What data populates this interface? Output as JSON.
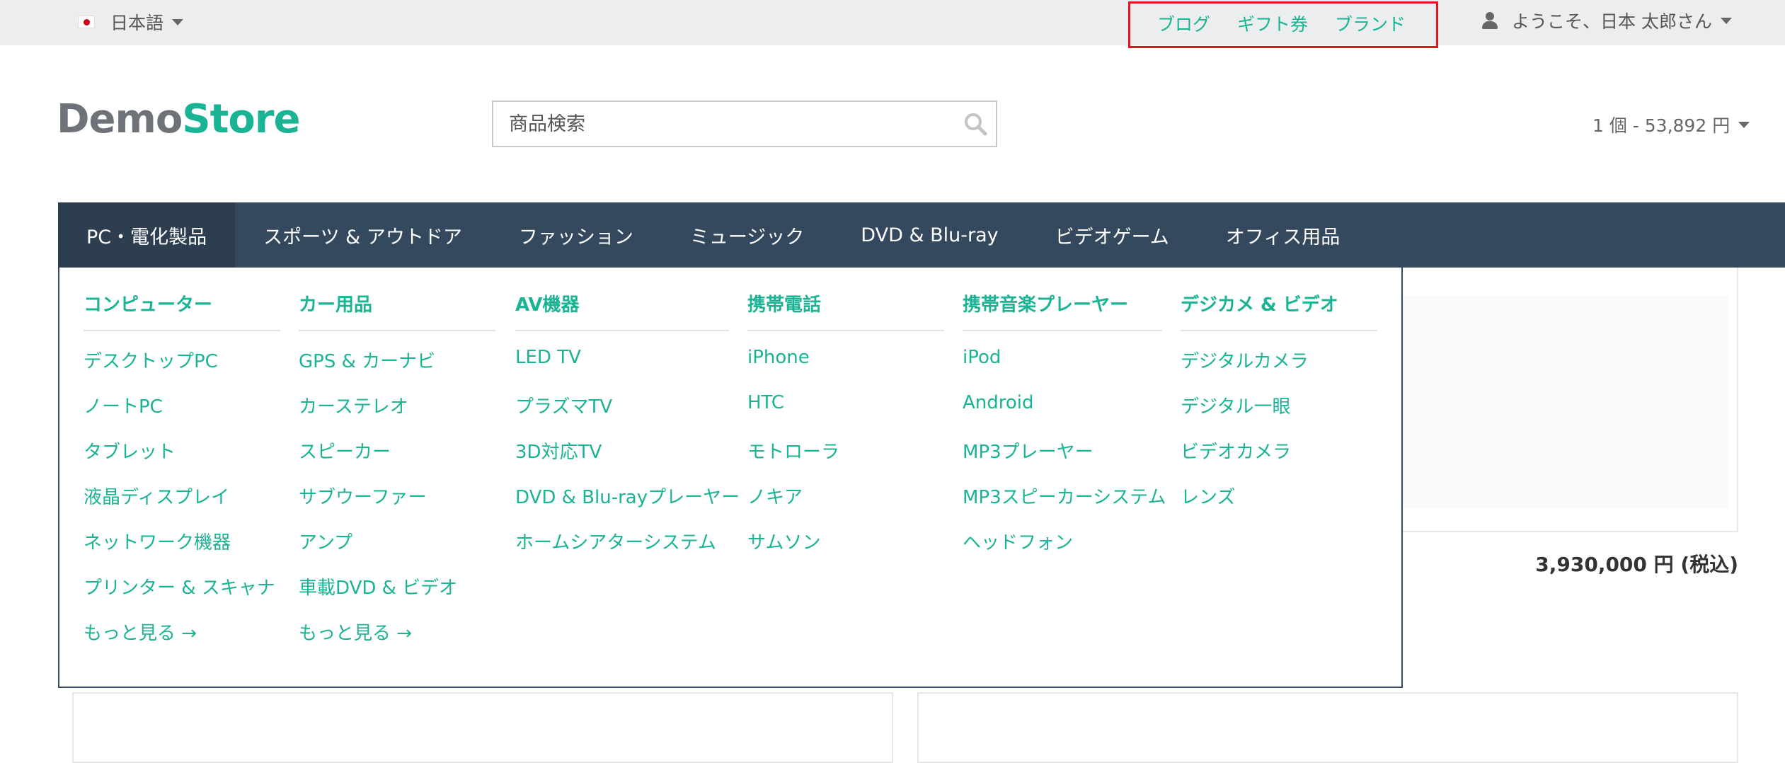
{
  "topbar": {
    "language": {
      "flag": "japan-flag",
      "label": "日本語"
    },
    "links": [
      {
        "label": "ブログ"
      },
      {
        "label": "ギフト券"
      },
      {
        "label": "ブランド"
      }
    ],
    "user": {
      "greeting": "ようこそ、日本 太郎さん"
    }
  },
  "header": {
    "logo": {
      "part1": "Demo",
      "part2": "Store"
    },
    "search": {
      "placeholder": "商品検索"
    },
    "cart": {
      "summary": "1 個 - 53,892 円"
    }
  },
  "nav": {
    "items": [
      {
        "label": "PC・電化製品",
        "active": true
      },
      {
        "label": "スポーツ & アウトドア"
      },
      {
        "label": "ファッション"
      },
      {
        "label": "ミュージック"
      },
      {
        "label": "DVD & Blu-ray"
      },
      {
        "label": "ビデオゲーム"
      },
      {
        "label": "オフィス用品"
      }
    ]
  },
  "menu": {
    "columns": [
      {
        "title": "コンピューター",
        "links": [
          "デスクトップPC",
          "ノートPC",
          "タブレット",
          "液晶ディスプレイ",
          "ネットワーク機器",
          "プリンター & スキャナ",
          "もっと見る →"
        ]
      },
      {
        "title": "カー用品",
        "links": [
          "GPS & カーナビ",
          "カーステレオ",
          "スピーカー",
          "サブウーファー",
          "アンプ",
          "車載DVD & ビデオ",
          "もっと見る →"
        ]
      },
      {
        "title": "AV機器",
        "links": [
          "LED TV",
          "プラズマTV",
          "3D対応TV",
          "DVD & Blu-rayプレーヤー",
          "ホームシアターシステム"
        ]
      },
      {
        "title": "携帯電話",
        "links": [
          "iPhone",
          "HTC",
          "モトローラ",
          "ノキア",
          "サムソン"
        ]
      },
      {
        "title": "携帯音楽プレーヤー",
        "links": [
          "iPod",
          "Android",
          "MP3プレーヤー",
          "MP3スピーカーシステム",
          "ヘッドフォン"
        ]
      },
      {
        "title": "デジカメ & ビデオ",
        "links": [
          "デジタルカメラ",
          "デジタル一眼",
          "ビデオカメラ",
          "レンズ"
        ]
      }
    ]
  },
  "product": {
    "price": "3,930,000 円 (税込)"
  },
  "colors": {
    "accent": "#1ab394",
    "nav_bg": "#34495e",
    "nav_active": "#2c3e50",
    "highlight": "#e8121f"
  }
}
